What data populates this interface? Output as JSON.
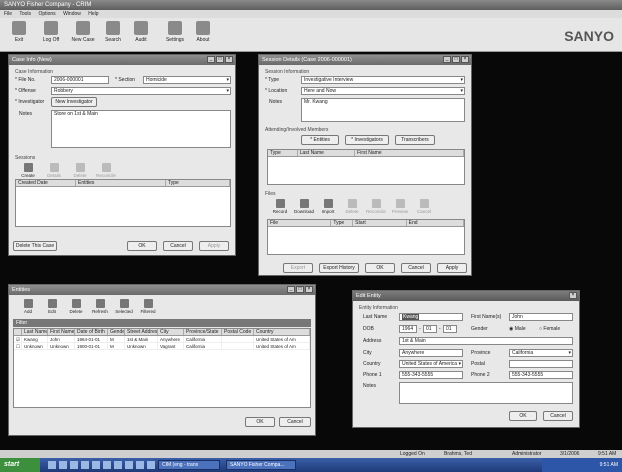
{
  "app": {
    "title": "SANYO Fisher Company - CRIM",
    "menu": [
      "File",
      "Tools",
      "Options",
      "Window",
      "Help"
    ],
    "brand": "SANYO",
    "toolbar": [
      {
        "label": "Exit",
        "icon": "exit-icon"
      },
      {
        "label": "Log Off",
        "icon": "log-off-icon"
      },
      {
        "label": "New Case",
        "icon": "new-case-icon"
      },
      {
        "label": "Search",
        "icon": "search-icon"
      },
      {
        "label": "Audit",
        "icon": "audit-icon"
      },
      {
        "label": "Settings",
        "icon": "settings-icon"
      },
      {
        "label": "About",
        "icon": "about-icon"
      }
    ]
  },
  "case_info": {
    "title": "Case Info (New)",
    "section": "Case Information",
    "file_no_label": "* File No.",
    "file_no": "2006-000001",
    "section_label": "* Section",
    "section_value": "Homicide",
    "offense_label": "* Offense",
    "offense_value": "Robbery",
    "investigator_label": "* Investigator",
    "new_investigator_btn": "New Investigator",
    "notes_label": "Notes",
    "notes": "Store on 1st & Main",
    "sessions_label": "Sessions",
    "tools": [
      "Create",
      "Details",
      "Delete",
      "Reconcile"
    ],
    "columns": [
      "Created Date",
      "Entities",
      "Type"
    ],
    "delete_case_btn": "Delete This Case",
    "ok": "OK",
    "cancel": "Cancel",
    "apply": "Apply"
  },
  "session_details": {
    "title": "Session Details (Case 2006-000001)",
    "section": "Session Information",
    "type_label": "* Type",
    "type_value": "Investigative Interview",
    "location_label": "* Location",
    "location_value": "Here and Now",
    "notes_label": "Notes",
    "notes": "Mr. Kwang",
    "members_label": "Attending/Involved Members",
    "entities_btn": "* Entities",
    "investigators_btn": "* Investigators",
    "transcribers_btn": "Transcribers",
    "member_columns": [
      "Type",
      "Last Name",
      "First Name"
    ],
    "files_label": "Files",
    "file_tools": [
      "Record",
      "Download",
      "Import",
      "Delete",
      "Reconcile",
      "Preview",
      "Cancel"
    ],
    "file_columns": [
      "File",
      "Type",
      "Start",
      "End"
    ],
    "export_btn": "Export",
    "export_history_btn": "Export History",
    "ok": "OK",
    "cancel": "Cancel",
    "apply": "Apply"
  },
  "entities": {
    "title": "Entities",
    "tools": [
      "Add",
      "Edit",
      "Delete",
      "Refresh",
      "Selected",
      "Filtered"
    ],
    "filter_label": "Filter",
    "columns": [
      "Last Name",
      "First Name",
      "Date of Birth",
      "Gender",
      "Street Address",
      "City",
      "Province/State",
      "Postal Code",
      "Country"
    ],
    "rows": [
      [
        "Kwang",
        "John",
        "1964-01-01",
        "M",
        "1st & Main",
        "Anywhere",
        "California",
        "",
        "United States of Am"
      ],
      [
        "Unknown",
        "Unknown",
        "1900-01-01",
        "M",
        "Unknown",
        "Vagrant",
        "California",
        "",
        "United States of Am"
      ]
    ],
    "ok": "OK",
    "cancel": "Cancel"
  },
  "edit_entity": {
    "title": "Edit Entity",
    "section": "Entity Information",
    "last_name_label": "Last Name",
    "last_name": "Kwang",
    "first_name_label": "First Name(s)",
    "first_name": "John",
    "dob_label": "DOB",
    "dob_year": "1964",
    "dob_month": "01",
    "dob_day": "01",
    "gender_label": "Gender",
    "male": "Male",
    "female": "Female",
    "address_label": "Address",
    "address": "1st & Main",
    "city_label": "City",
    "city": "Anywhere",
    "province_label": "Province",
    "province": "California",
    "country_label": "Country",
    "country": "United States of America",
    "postal_label": "Postal",
    "phone1_label": "Phone 1",
    "phone1": "555-343-5555",
    "phone2_label": "Phone 2",
    "phone2": "555-343-5555",
    "notes_label": "Notes",
    "ok": "OK",
    "cancel": "Cancel"
  },
  "status": {
    "logged_on": "Logged On",
    "user": "Brahms, Ted",
    "role": "Administrator",
    "date": "3/1/2006",
    "time": "9:51 AM"
  },
  "taskbar": {
    "start": "start",
    "tasks": [
      "CIM (eng - trans",
      "SANYO Fisher Compa..."
    ],
    "clock": "9:51 AM"
  }
}
